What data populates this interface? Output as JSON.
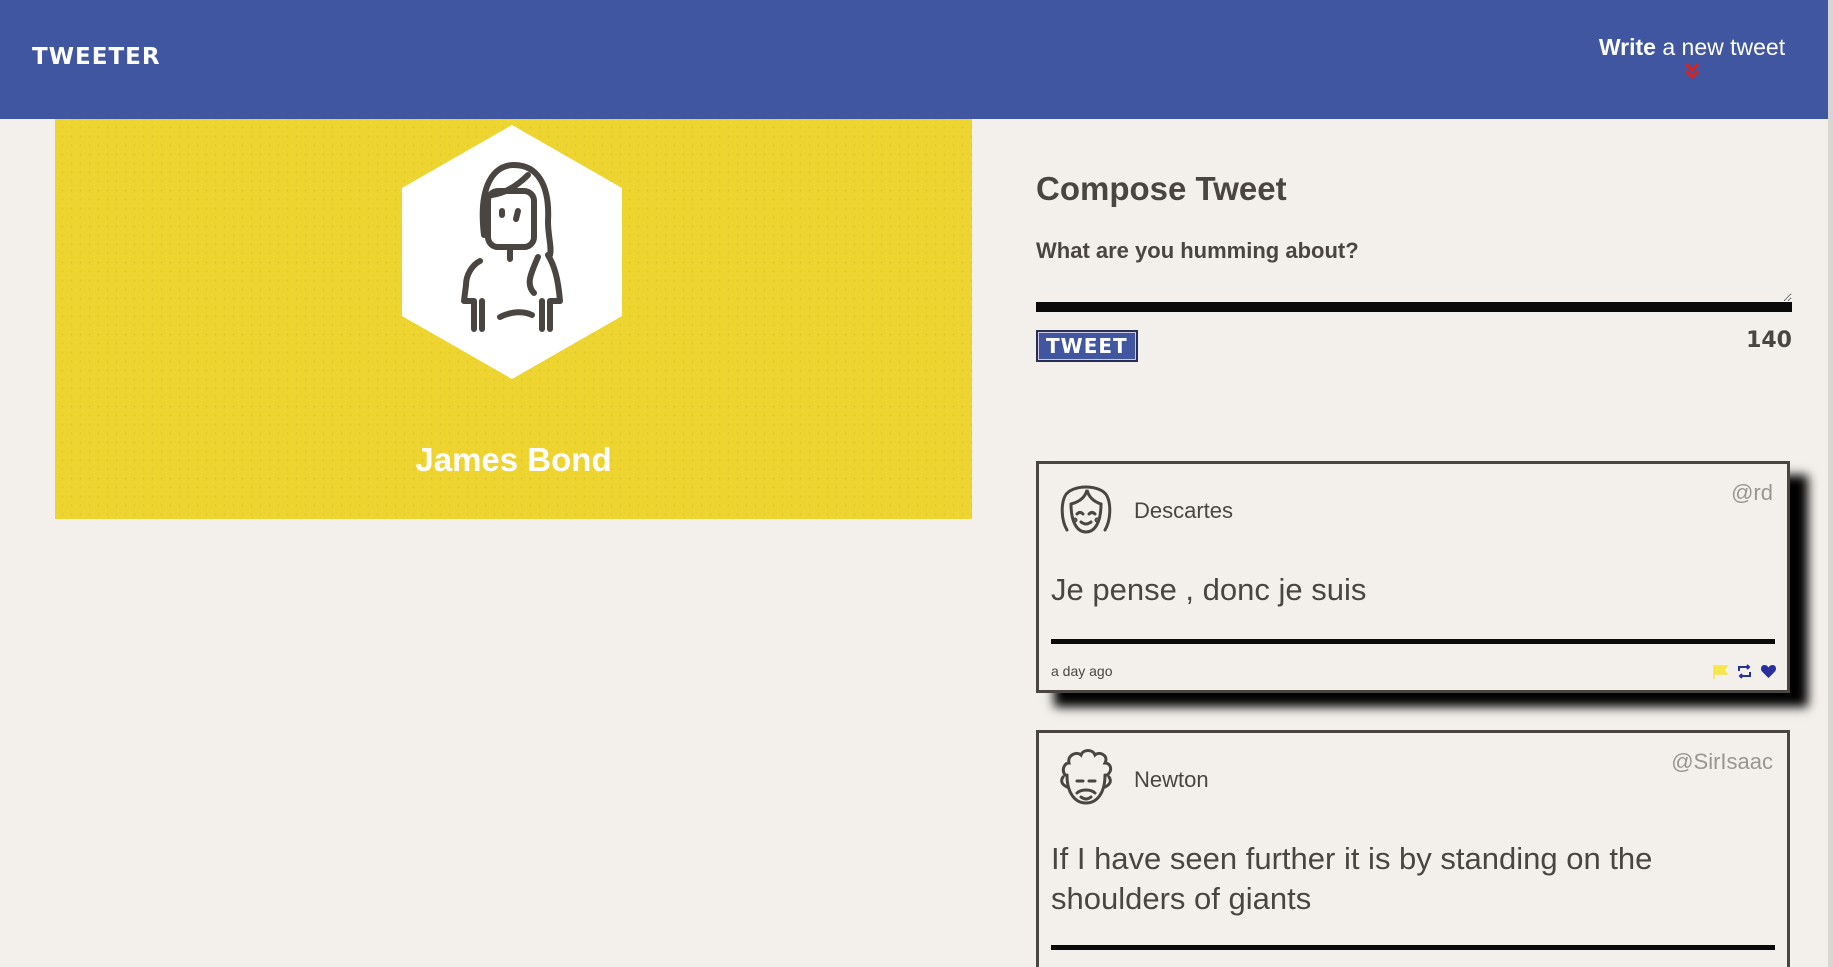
{
  "nav": {
    "brand": "TWEETER",
    "write_strong": "Write",
    "write_rest": " a new tweet",
    "chevron_icon": "double-chevron-down-icon"
  },
  "profile": {
    "name": "James Bond",
    "avatar_icon": "female-avatar-icon",
    "background_color": "#edd42e"
  },
  "compose": {
    "title": "Compose Tweet",
    "prompt": "What are you humming about?",
    "textarea_value": "",
    "button_label": "TWEET",
    "counter": "140"
  },
  "tweets": [
    {
      "name": "Descartes",
      "handle": "@rd",
      "content": "Je pense , donc je suis",
      "time": "a day ago",
      "avatar_icon": "girl-face-avatar-icon"
    },
    {
      "name": "Newton",
      "handle": "@SirIsaac",
      "content": "If I have seen further it is by standing on the shoulders of giants",
      "avatar_icon": "curly-hair-avatar-icon"
    }
  ],
  "actions": {
    "flag_icon": "flag-icon",
    "retweet_icon": "retweet-icon",
    "like_icon": "heart-icon"
  },
  "colors": {
    "nav": "#4056a1",
    "accent_red": "#e0201b",
    "flag": "#f5e64b",
    "action_blue": "#2a2f9e",
    "text": "#4a4540"
  }
}
